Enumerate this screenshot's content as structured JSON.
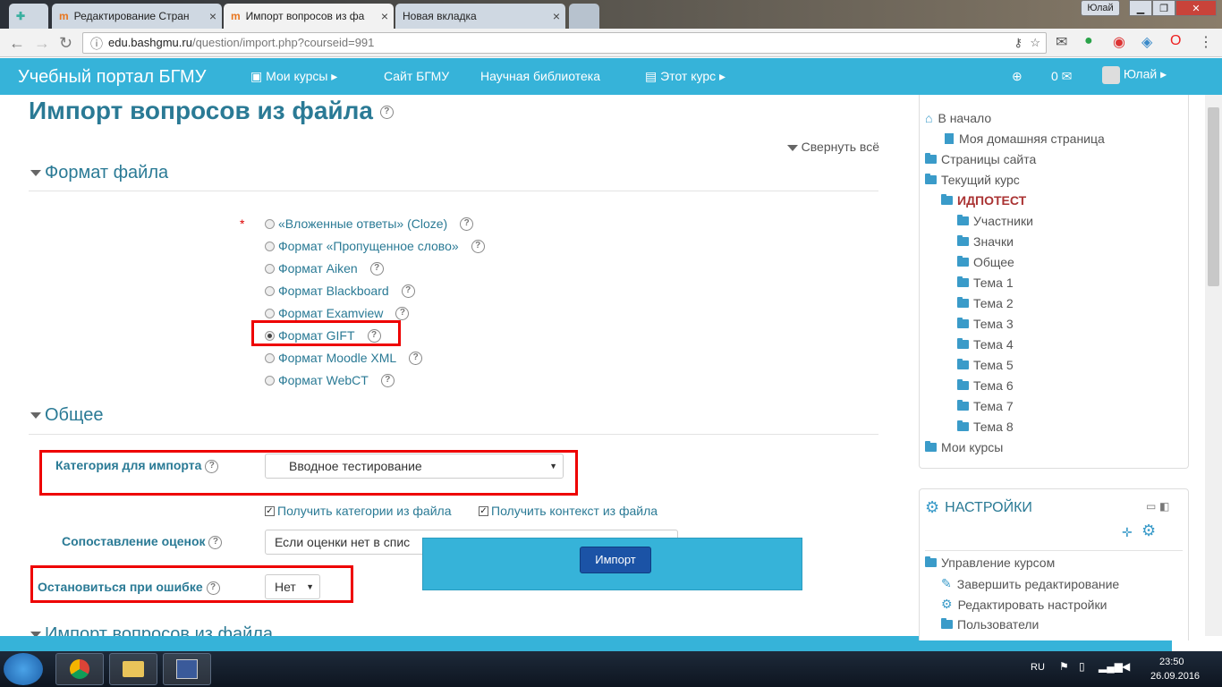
{
  "browser": {
    "tabs": [
      {
        "label": "Редактирование Стран"
      },
      {
        "label": "Импорт вопросов из фа"
      },
      {
        "label": "Новая вкладка"
      }
    ],
    "profile_label": "Юлай",
    "url_host": "edu.bashgmu.ru",
    "url_path": "/question/import.php?courseid=991"
  },
  "navbar": {
    "brand": "Учебный портал БГМУ",
    "my_courses": "Мои курсы",
    "site": "Сайт БГМУ",
    "library": "Научная библиотека",
    "this_course": "Этот курс",
    "messages_count": "0",
    "user": "Юлай"
  },
  "main": {
    "title": "Импорт вопросов из файла",
    "collapse_all": "Свернуть всё",
    "sections": {
      "file_format": "Формат файла",
      "general": "Общее",
      "import": "Импорт вопросов из файла"
    },
    "formats": [
      "«Вложенные ответы» (Cloze)",
      "Формат «Пропущенное слово»",
      "Формат Aiken",
      "Формат Blackboard",
      "Формат Examview",
      "Формат GIFT",
      "Формат Moodle XML",
      "Формат WebCT"
    ],
    "required_mark": "*",
    "category_label": "Категория для импорта",
    "category_value": "Вводное тестирование",
    "get_categories": "Получить категории из файла",
    "get_context": "Получить контекст из файла",
    "grade_match_label": "Сопоставление оценок",
    "grade_match_value": "Если оценки нет в спис",
    "stop_on_error_label": "Остановиться при ошибке",
    "stop_on_error_value": "Нет",
    "import_button": "Импорт"
  },
  "sidebar": {
    "items": [
      "В начало",
      "Моя домашняя страница",
      "Страницы сайта",
      "Текущий курс",
      "ИДПОТЕСТ",
      "Участники",
      "Значки",
      "Общее",
      "Тема 1",
      "Тема 2",
      "Тема 3",
      "Тема 4",
      "Тема 5",
      "Тема 6",
      "Тема 7",
      "Тема 8",
      "Мои курсы"
    ],
    "settings_title": "НАСТРОЙКИ",
    "settings_items": [
      "Управление курсом",
      "Завершить редактирование",
      "Редактировать настройки",
      "Пользователи"
    ]
  },
  "taskbar": {
    "lang": "RU",
    "time": "23:50",
    "date": "26.09.2016"
  }
}
